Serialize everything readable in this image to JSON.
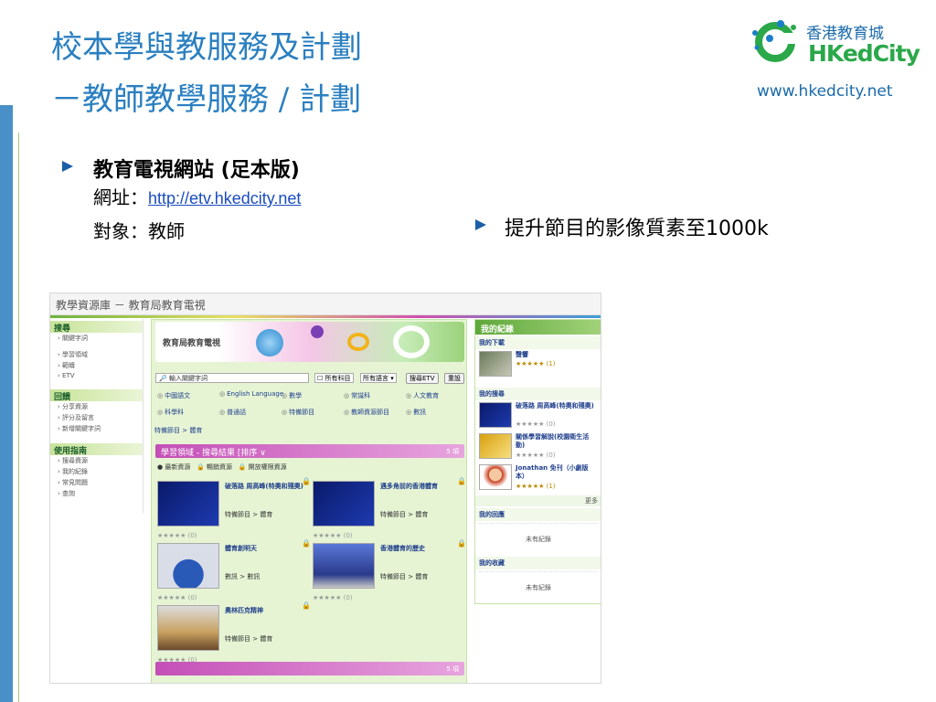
{
  "slide": {
    "title_line1": "校本學與教服務及計劃",
    "title_line2": "－教師教學服務 / 計劃",
    "logo_chinese": "香港教育城",
    "logo_english": "HKedCity",
    "logo_url": "www.hkedcity.net",
    "bullet1_title": "教育電視網站 (足本版)",
    "bullet1_url_label": "網址：",
    "bullet1_url": "http://etv.hkedcity.net",
    "bullet1_audience": "對象：教師",
    "bullet2": "提升節目的影像質素至1000k"
  },
  "screenshot": {
    "window_title": "教學資源庫 － 教育局教育電視",
    "sidebar": [
      {
        "head": "搜尋",
        "items": [
          "關鍵字詞",
          "學習領域",
          "範疇",
          "ETV"
        ]
      },
      {
        "head": "回饋",
        "items": [
          "分享資源",
          "評分及留言",
          "新增關鍵字詞"
        ]
      },
      {
        "head": "使用指南",
        "items": [
          "搜尋資源",
          "我的紀錄",
          "常見問題",
          "查詢"
        ]
      }
    ],
    "banner_title": "教育局教育電視",
    "search_placeholder": "輸入關鍵字詞",
    "all_subjects": "所有科目",
    "all_languages": "所有語言",
    "search_button": "搜尋ETV",
    "reset_button": "重設",
    "subjects": [
      "中國語文",
      "English Language",
      "數學",
      "常識科",
      "人文教育",
      "科學科",
      "普通話",
      "特備節目",
      "教師資源節目",
      "數訊"
    ],
    "breadcrumb": "特備節目 > 體育",
    "results_title": "學習領域 - 搜尋結果 [排序 ∨",
    "results_count": "5 項",
    "toolbar": [
      "最新資源",
      "暢銷資源",
      "開放權限資源"
    ],
    "results": [
      {
        "title": "破落路 周高峰(特奧和殘奧)",
        "category": "特備節目 > 體育",
        "rating": "★★★★★ (0)"
      },
      {
        "title": "遇多角前的香港體育",
        "category": "特備節目 > 體育",
        "rating": "★★★★★ (0)"
      },
      {
        "title": "體育創明天",
        "category": "數訊 > 數訊",
        "rating": "★★★★★ (0)"
      },
      {
        "title": "香港體育的歷史",
        "category": "特備節目 > 體育",
        "rating": "★★★★★ (0)"
      },
      {
        "title": "奧林匹克精神",
        "category": "特備節目 > 體育",
        "rating": "★★★★★ (0)"
      }
    ],
    "footer_count": "5 項",
    "right": {
      "title": "我的紀錄",
      "downloads_label": "我的下載",
      "downloads": [
        {
          "title": "聲響",
          "rating": "★★★★★ (1)"
        }
      ],
      "searches_label": "我的搜尋",
      "searches": [
        {
          "title": "破落路 周高峰(特奧和殘奧)",
          "rating": "★★★★★ (0)"
        },
        {
          "title": "關係學習解說(校園衛生活動)",
          "rating": "★★★★★ (0)"
        },
        {
          "title": "Jonathan 免刊（小劇版本）",
          "rating": "★★★★★ (1)"
        }
      ],
      "more": "更多",
      "feedback_label": "我的回應",
      "feedback_empty": "未有紀錄",
      "favorites_label": "我的收藏",
      "favorites_empty": "未有紀錄"
    }
  }
}
